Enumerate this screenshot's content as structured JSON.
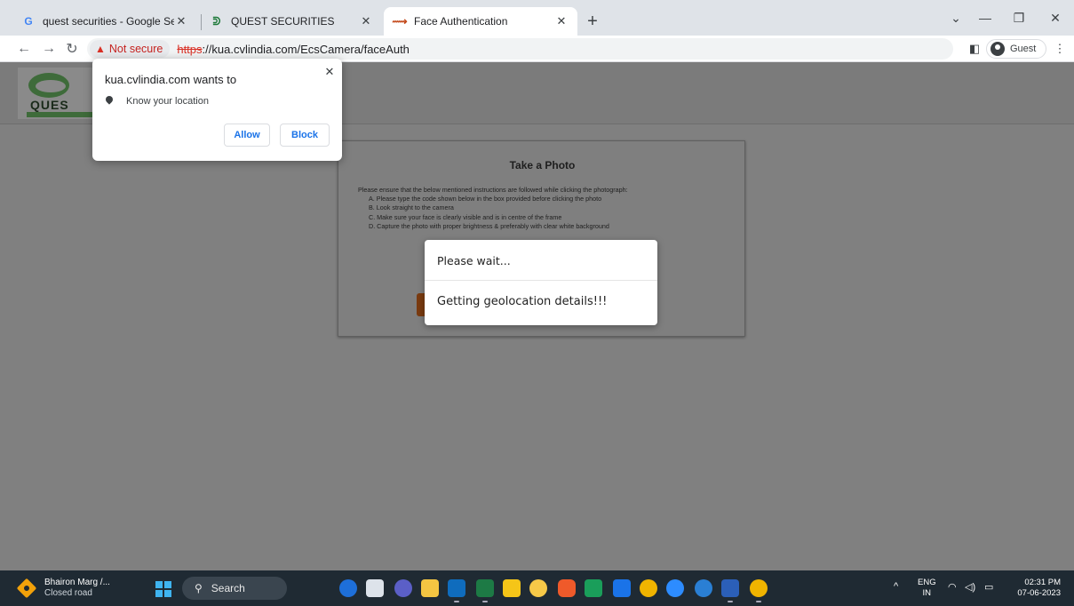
{
  "tabs": [
    {
      "title": "quest securities - Google Search",
      "icon": "google-icon"
    },
    {
      "title": "QUEST SECURITIES",
      "icon": "quest-icon"
    },
    {
      "title": "Face Authentication",
      "icon": "face-auth-icon"
    }
  ],
  "toolbar": {
    "security_chip": "Not secure",
    "url_scheme": "https",
    "url_rest": "://kua.cvlindia.com/EcsCamera/faceAuth",
    "profile_label": "Guest"
  },
  "permission_prompt": {
    "title": "kua.cvlindia.com wants to",
    "permission": "Know your location",
    "allow_label": "Allow",
    "block_label": "Block"
  },
  "page": {
    "logo_text": "QUES",
    "card_title": "Take a Photo",
    "instructions_intro": "Please ensure that the below mentioned instructions are followed while clicking the photograph:",
    "instructions": [
      "A. Please type the code shown below in the box provided before clicking the photo",
      "B. Look straight to the camera",
      "C. Make sure your face is clearly visible and is in centre of the frame",
      "D. Capture the photo with proper brightness & preferably with clear white background"
    ]
  },
  "loading_modal": {
    "header": "Please wait...",
    "message": "Getting geolocation details!!!"
  },
  "taskbar": {
    "weather_line1": "Bhairon Marg /...",
    "weather_line2": "Closed road",
    "search_placeholder": "Search",
    "lang_line1": "ENG",
    "lang_line2": "IN",
    "time": "02:31 PM",
    "date": "07-06-2023",
    "apps": [
      "bing-icon",
      "task-view-icon",
      "teams-icon",
      "file-explorer-icon",
      "outlook-icon",
      "excel-icon",
      "sticky-notes-icon",
      "tips-icon",
      "brave-icon",
      "sheets-icon",
      "mail-icon",
      "chrome-icon",
      "zoom-icon",
      "app-badge-icon",
      "word-icon",
      "chrome-active-icon"
    ]
  }
}
